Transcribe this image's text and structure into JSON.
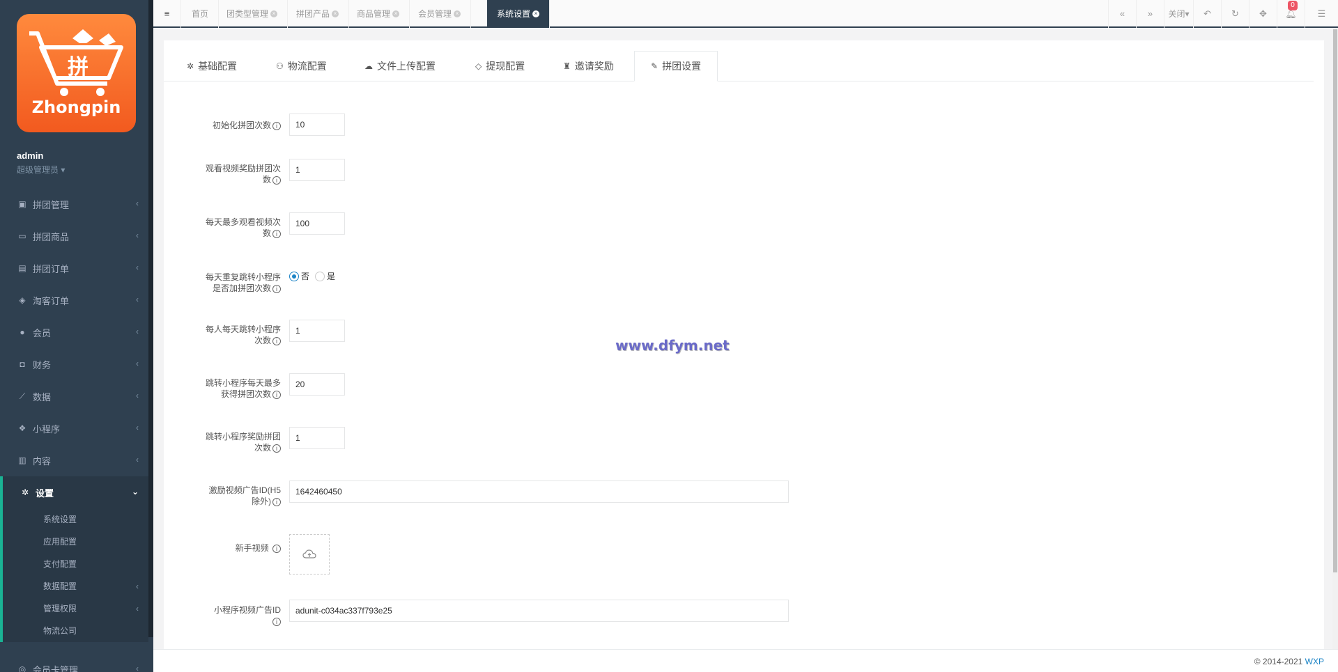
{
  "brand": {
    "logo_text": "Zhongpin"
  },
  "user": {
    "name": "admin",
    "role": "超级管理员 ▾"
  },
  "menu": [
    {
      "label": "拼团管理",
      "icon": "bus-icon"
    },
    {
      "label": "拼团商品",
      "icon": "laptop-icon"
    },
    {
      "label": "拼团订单",
      "icon": "file-icon"
    },
    {
      "label": "淘客订单",
      "icon": "cube-icon"
    },
    {
      "label": "会员",
      "icon": "user-icon"
    },
    {
      "label": "财务",
      "icon": "money-icon"
    },
    {
      "label": "数据",
      "icon": "chart-icon"
    },
    {
      "label": "小程序",
      "icon": "cubes-icon"
    },
    {
      "label": "内容",
      "icon": "book-icon"
    },
    {
      "label": "设置",
      "icon": "gear-icon"
    },
    {
      "label": "会员卡管理",
      "icon": "card-icon"
    }
  ],
  "submenu": [
    {
      "label": "系统设置"
    },
    {
      "label": "应用配置"
    },
    {
      "label": "支付配置"
    },
    {
      "label": "数据配置"
    },
    {
      "label": "管理权限"
    },
    {
      "label": "物流公司"
    }
  ],
  "topbar": {
    "tabs": [
      {
        "label": "首页"
      },
      {
        "label": "团类型管理"
      },
      {
        "label": "拼团产品"
      },
      {
        "label": "商品管理"
      },
      {
        "label": "会员管理"
      },
      {
        "label": "系统设置"
      }
    ],
    "close_label": "关闭",
    "notifications": "0"
  },
  "settings_tabs": [
    {
      "label": "基础配置",
      "icon": "gear-icon"
    },
    {
      "label": "物流配置",
      "icon": "motorcycle-icon"
    },
    {
      "label": "文件上传配置",
      "icon": "cloud-upload-icon"
    },
    {
      "label": "提现配置",
      "icon": "diamond-icon"
    },
    {
      "label": "邀请奖励",
      "icon": "user-secret-icon"
    },
    {
      "label": "拼团设置",
      "icon": "paint-brush-icon"
    }
  ],
  "form": {
    "init_count": {
      "label": "初始化拼团次数",
      "value": "10"
    },
    "video_reward": {
      "label1": "观看视频奖励拼团次",
      "label2": "数",
      "value": "1"
    },
    "daily_video_max": {
      "label1": "每天最多观看视频次",
      "label2": "数",
      "value": "100"
    },
    "repeat_jump": {
      "label1": "每天重复跳转小程序",
      "label2": "是否加拼团次数",
      "opt_no": "否",
      "opt_yes": "是"
    },
    "daily_jump": {
      "label1": "每人每天跳转小程序",
      "label2": "次数",
      "value": "1"
    },
    "jump_daily_max": {
      "label1": "跳转小程序每天最多",
      "label2": "获得拼团次数",
      "value": "20"
    },
    "jump_reward": {
      "label1": "跳转小程序奖励拼团",
      "label2": "次数",
      "value": "1"
    },
    "reward_ad_id": {
      "label1": "激励视频广告ID(H5",
      "label2": "除外)",
      "value": "1642460450"
    },
    "newbie_video": {
      "label": "新手视频"
    },
    "mp_video_ad": {
      "label1": "小程序视频广告ID",
      "value": "adunit-c034ac337f793e25"
    }
  },
  "watermark": "www.dfym.net",
  "footer": {
    "copyright": "© 2014-2021 ",
    "link": "WXP"
  }
}
